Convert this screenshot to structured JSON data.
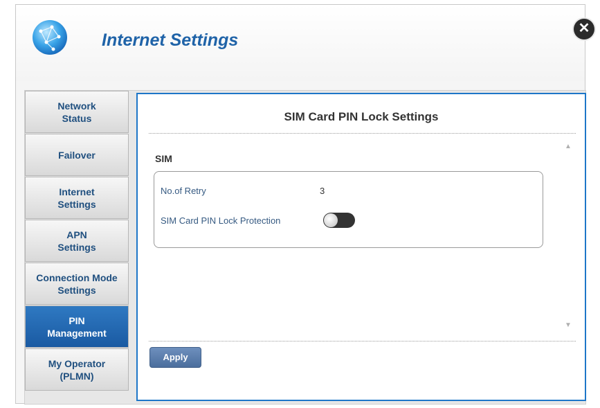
{
  "dialog": {
    "title": "Internet Settings",
    "close_icon": "close-icon",
    "logo_icon": "globe-network-icon"
  },
  "sidebar": {
    "items": [
      {
        "label": "Network\nStatus",
        "active": false
      },
      {
        "label": "Failover",
        "active": false
      },
      {
        "label": "Internet\nSettings",
        "active": false
      },
      {
        "label": "APN\nSettings",
        "active": false
      },
      {
        "label": "Connection Mode\nSettings",
        "active": false
      },
      {
        "label": "PIN\nManagement",
        "active": true
      },
      {
        "label": "My Operator\n(PLMN)",
        "active": false
      }
    ]
  },
  "panel": {
    "title": "SIM Card PIN Lock Settings",
    "section_label": "SIM",
    "retry_label": "No.of Retry",
    "retry_value": "3",
    "pin_lock_label": "SIM Card PIN Lock Protection",
    "pin_lock_enabled": false,
    "apply_label": "Apply"
  },
  "colors": {
    "accent": "#1d76c8",
    "title": "#1f63a8",
    "active_tab": "#2366ae",
    "apply_button": "#5a7eae"
  }
}
